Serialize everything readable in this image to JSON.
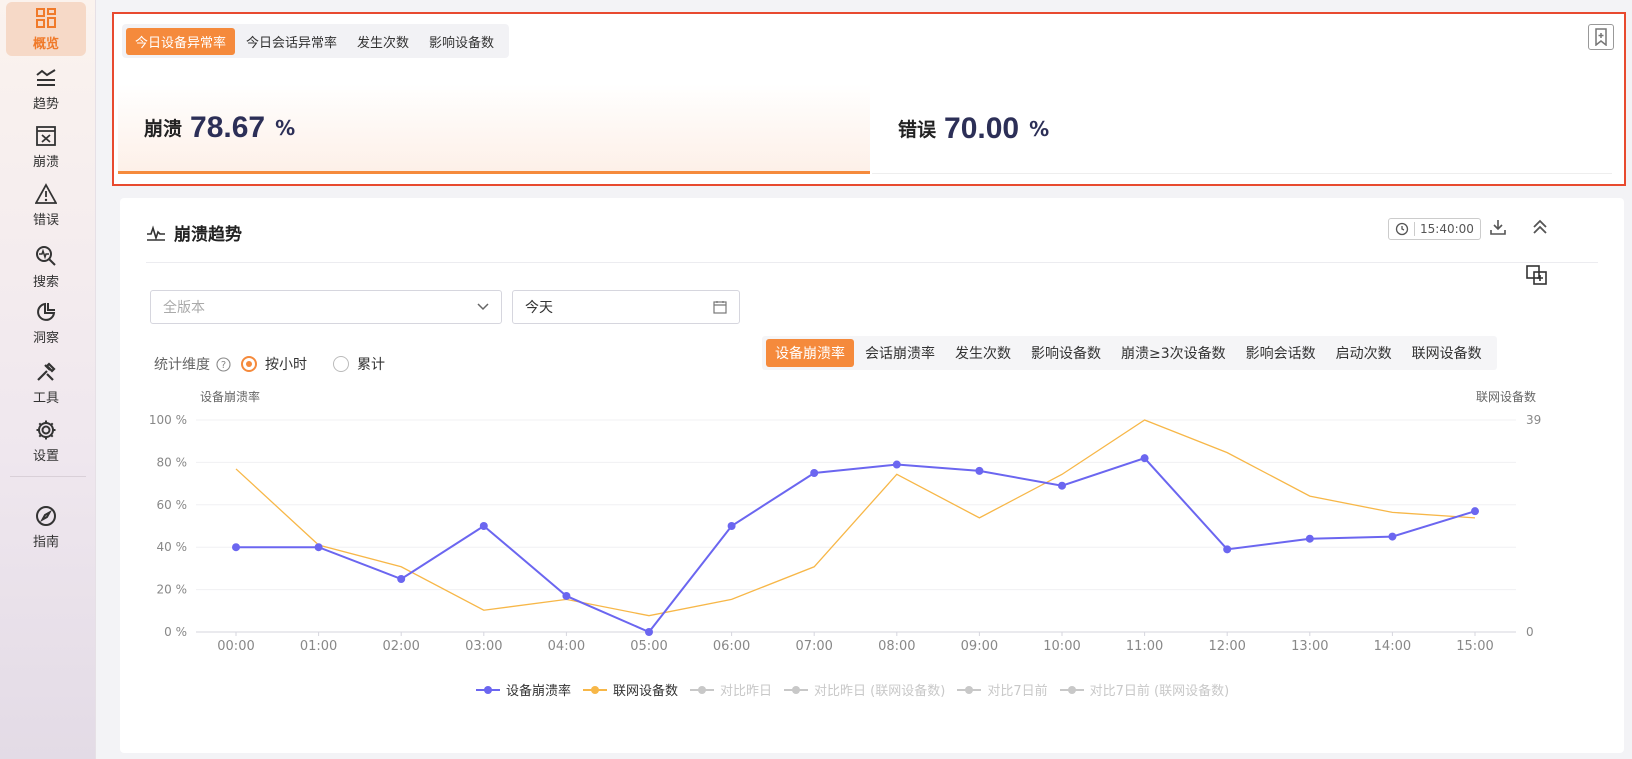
{
  "sidebar": {
    "items": [
      {
        "label": "概览",
        "icon": "dashboard-icon"
      },
      {
        "label": "趋势",
        "icon": "trend-icon"
      },
      {
        "label": "崩溃",
        "icon": "crash-icon"
      },
      {
        "label": "错误",
        "icon": "warning-icon"
      },
      {
        "label": "搜索",
        "icon": "search-icon"
      },
      {
        "label": "洞察",
        "icon": "insight-icon"
      },
      {
        "label": "工具",
        "icon": "tools-icon"
      },
      {
        "label": "设置",
        "icon": "gear-icon"
      },
      {
        "label": "指南",
        "icon": "compass-icon"
      }
    ]
  },
  "overview": {
    "tabs": [
      "今日设备异常率",
      "今日会话异常率",
      "发生次数",
      "影响设备数"
    ],
    "metrics": [
      {
        "label": "崩溃",
        "value": "78.67",
        "unit": "%"
      },
      {
        "label": "错误",
        "value": "70.00",
        "unit": "%"
      }
    ]
  },
  "trend": {
    "title": "崩溃趋势",
    "time": "15:40:00",
    "version_placeholder": "全版本",
    "date_value": "今天",
    "dimension_label": "统计维度",
    "radio_options": [
      "按小时",
      "累计"
    ],
    "metric_tabs": [
      "设备崩溃率",
      "会话崩溃率",
      "发生次数",
      "影响设备数",
      "崩溃≥3次设备数",
      "影响会话数",
      "启动次数",
      "联网设备数"
    ]
  },
  "colors": {
    "accent": "#f58a3c",
    "series1": "#6b66f0",
    "series2": "#f7b748",
    "disabled": "#c8c8c8"
  },
  "chart_data": {
    "type": "line",
    "x": [
      "00:00",
      "01:00",
      "02:00",
      "03:00",
      "04:00",
      "05:00",
      "06:00",
      "07:00",
      "08:00",
      "09:00",
      "10:00",
      "11:00",
      "12:00",
      "13:00",
      "14:00",
      "15:00"
    ],
    "ylabel_left": "设备崩溃率",
    "ylabel_right": "联网设备数",
    "y_left_ticks": [
      "0 %",
      "20 %",
      "40 %",
      "60 %",
      "80 %",
      "100 %"
    ],
    "y_right_ticks": [
      "0",
      "39"
    ],
    "ylim_left": [
      0,
      100
    ],
    "ylim_right": [
      0,
      39
    ],
    "series": [
      {
        "name": "设备崩溃率",
        "axis": "left",
        "values": [
          40,
          40,
          25,
          50,
          17,
          0,
          50,
          75,
          79,
          76,
          69,
          82,
          39,
          44,
          45,
          57
        ]
      },
      {
        "name": "联网设备数",
        "axis": "right",
        "values": [
          30,
          16,
          12,
          4,
          6,
          3,
          6,
          12,
          29,
          21,
          29,
          39,
          33,
          25,
          22,
          21
        ]
      }
    ],
    "legend": [
      "设备崩溃率",
      "联网设备数",
      "对比昨日",
      "对比昨日 (联网设备数)",
      "对比7日前",
      "对比7日前 (联网设备数)"
    ],
    "legend_position": "bottom",
    "grid": true
  }
}
